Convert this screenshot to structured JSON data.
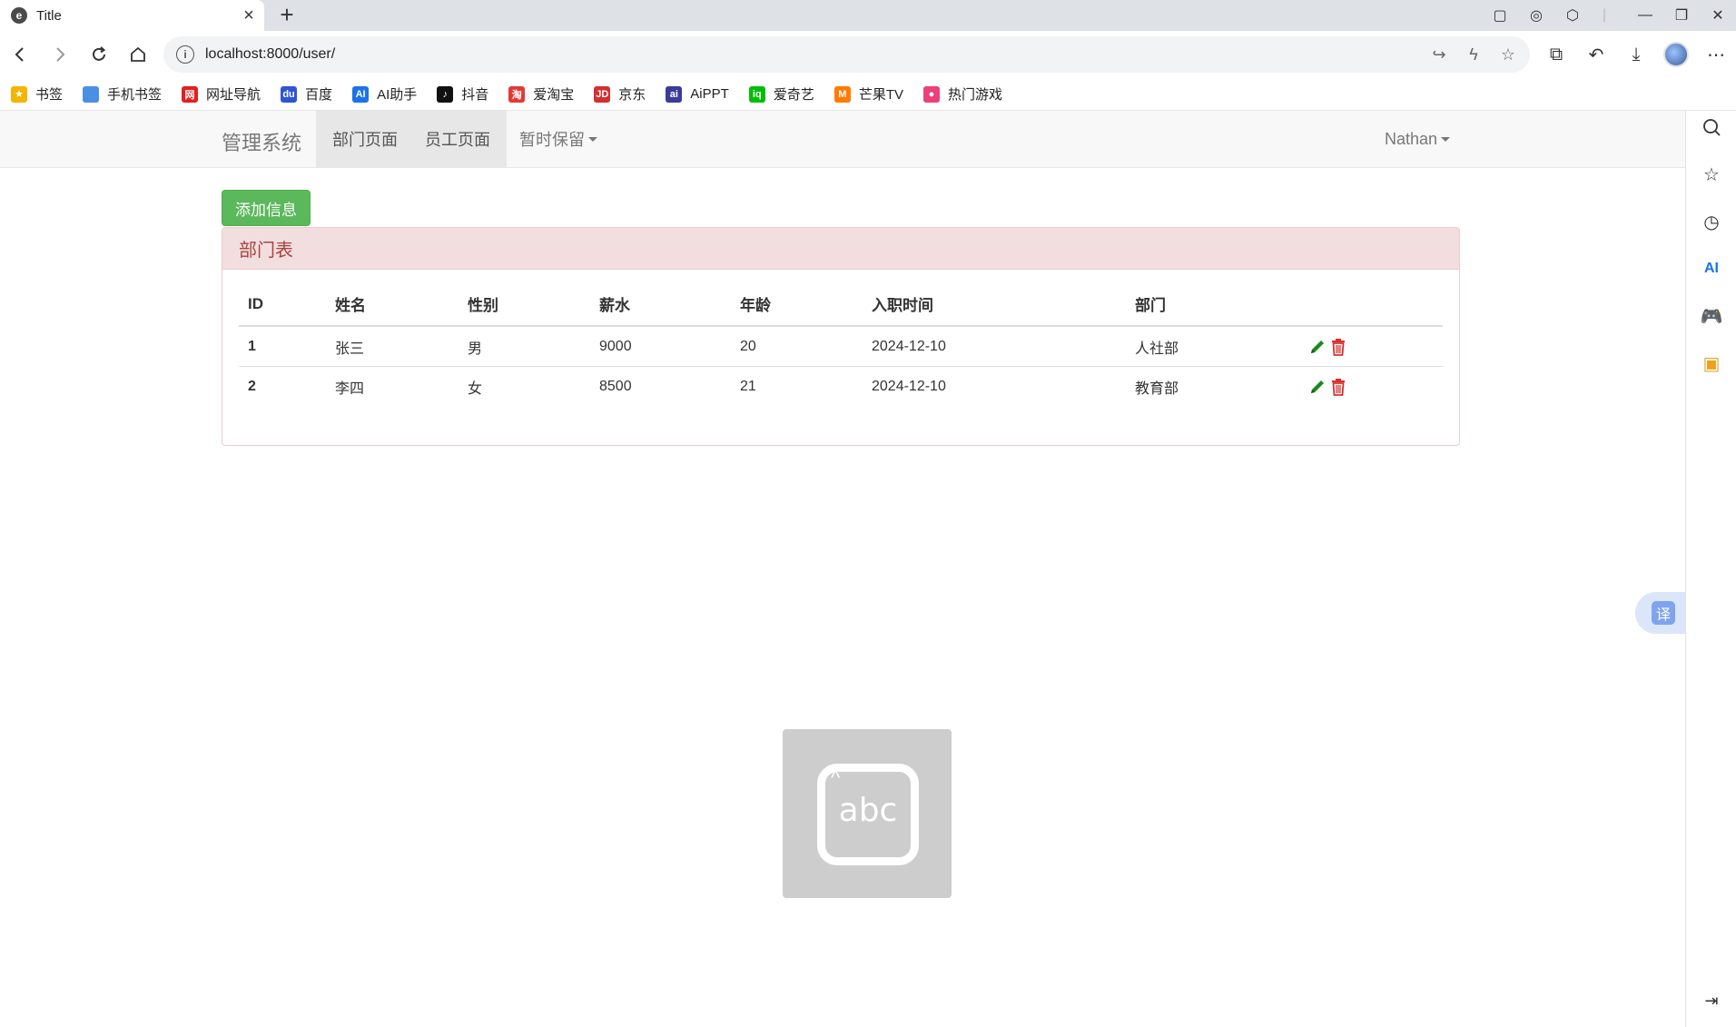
{
  "browser": {
    "tab_title": "Title",
    "tab_favicon": "e",
    "url": "localhost:8000/user/",
    "bookmarks": [
      {
        "label": "书签",
        "icon": "star-icon",
        "color": "#f5b400",
        "glyph": "★"
      },
      {
        "label": "手机书签",
        "icon": "phone-icon",
        "color": "#4a90e2",
        "glyph": ""
      },
      {
        "label": "网址导航",
        "icon": "nav-icon",
        "color": "#e02020",
        "glyph": "网"
      },
      {
        "label": "百度",
        "icon": "baidu-icon",
        "color": "#2f55d4",
        "glyph": "du"
      },
      {
        "label": "AI助手",
        "icon": "ai-assistant-icon",
        "color": "#1a73e8",
        "glyph": "AI"
      },
      {
        "label": "抖音",
        "icon": "douyin-icon",
        "color": "#111111",
        "glyph": "♪"
      },
      {
        "label": "爱淘宝",
        "icon": "taobao-icon",
        "color": "#e53935",
        "glyph": "淘"
      },
      {
        "label": "京东",
        "icon": "jd-icon",
        "color": "#d32f2f",
        "glyph": "JD"
      },
      {
        "label": "AiPPT",
        "icon": "aippt-icon",
        "color": "#3b3b98",
        "glyph": "ai"
      },
      {
        "label": "爱奇艺",
        "icon": "iqiyi-icon",
        "color": "#00be06",
        "glyph": "iq"
      },
      {
        "label": "芒果TV",
        "icon": "mango-icon",
        "color": "#ff7a00",
        "glyph": "M"
      },
      {
        "label": "热门游戏",
        "icon": "games-icon",
        "color": "#ec407a",
        "glyph": "●"
      }
    ],
    "translate_label": "译"
  },
  "navbar": {
    "brand": "管理系统",
    "items": [
      "部门页面",
      "员工页面"
    ],
    "dropdown": "暂时保留",
    "user": "Nathan"
  },
  "page": {
    "add_button": "添加信息",
    "panel_title": "部门表",
    "columns": [
      "ID",
      "姓名",
      "性别",
      "薪水",
      "年龄",
      "入职时间",
      "部门"
    ],
    "rows": [
      {
        "id": "1",
        "name": "张三",
        "gender": "男",
        "salary": "9000",
        "age": "20",
        "hire_date": "2024-12-10",
        "dept": "人社部"
      },
      {
        "id": "2",
        "name": "李四",
        "gender": "女",
        "salary": "8500",
        "age": "21",
        "hire_date": "2024-12-10",
        "dept": "教育部"
      }
    ],
    "colors": {
      "edit": "#1a8a1a",
      "delete": "#d9302c",
      "panel_heading_bg": "#f2dede",
      "panel_heading_text": "#a94442",
      "btn_success": "#5cb85c"
    }
  },
  "ime_overlay": {
    "text": "abc"
  }
}
